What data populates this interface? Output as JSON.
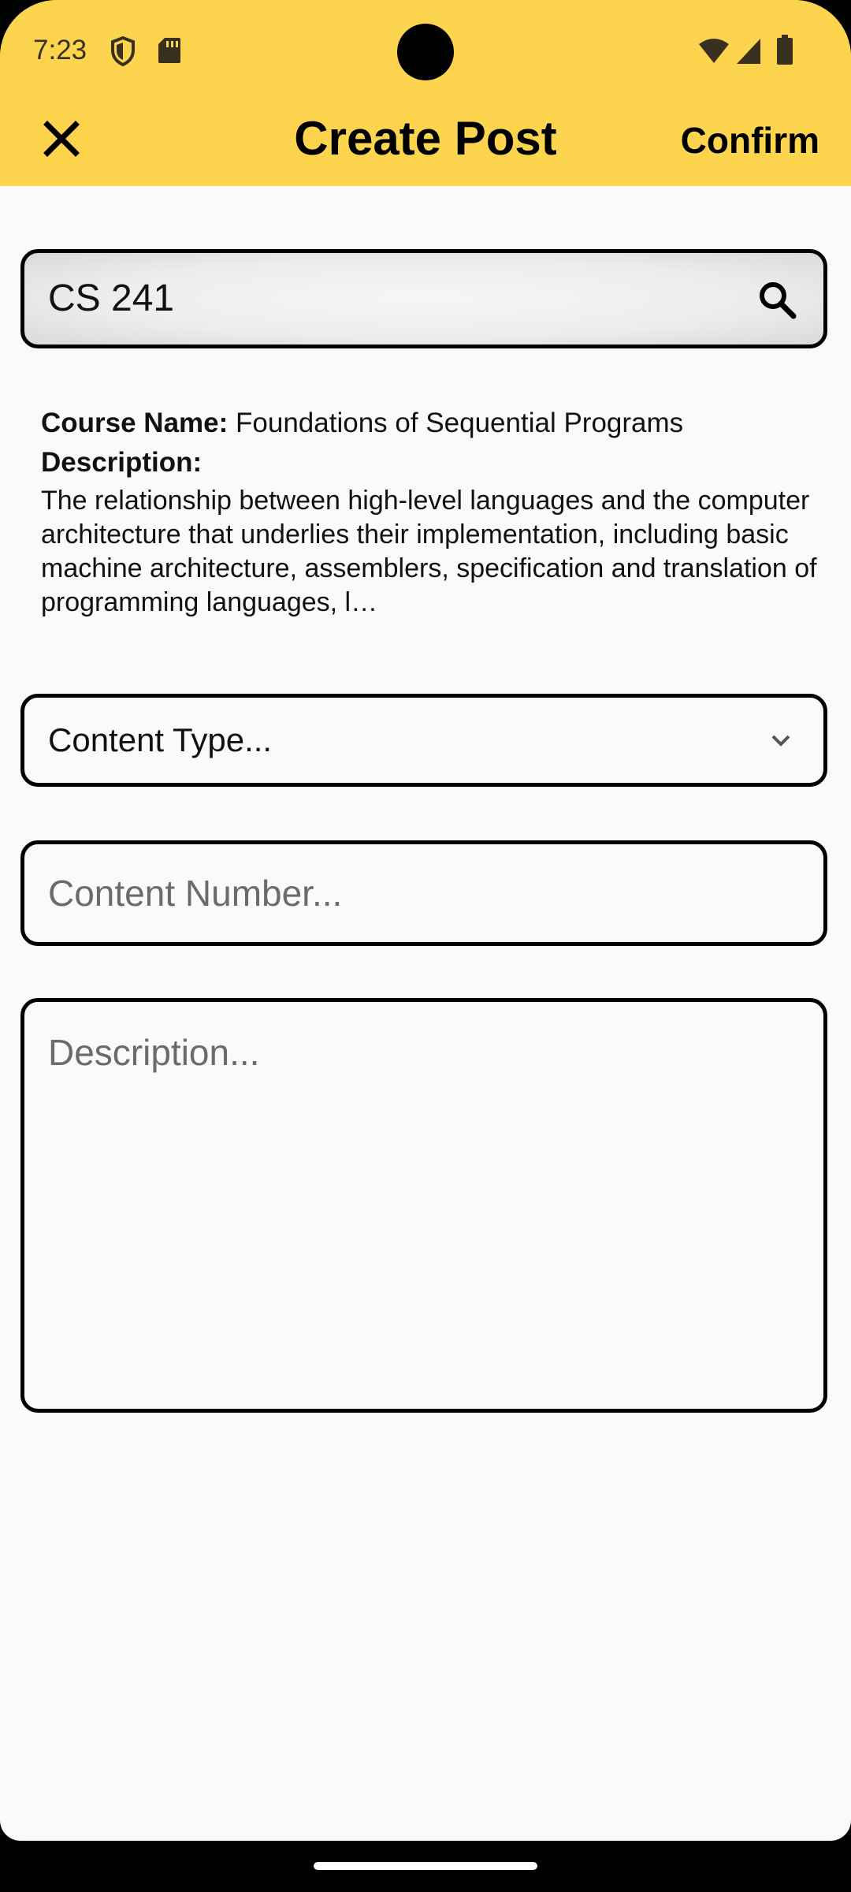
{
  "status_bar": {
    "time": "7:23",
    "left_icons": [
      "shield-icon",
      "sd-card-icon"
    ],
    "right_icons": [
      "wifi-icon",
      "signal-icon",
      "battery-icon"
    ]
  },
  "header": {
    "title": "Create Post",
    "confirm_label": "Confirm",
    "close_icon": "close-icon",
    "background_color": "#fdd44e"
  },
  "search": {
    "value": "CS 241",
    "icon": "search-icon"
  },
  "course": {
    "name_label": "Course Name:",
    "name_value": "Foundations of Sequential Programs",
    "description_label": "Description:",
    "description_value": "The relationship between high-level languages and the computer architecture that underlies their implementation, including basic machine architecture, assemblers, specification and translation of programming languages, l…"
  },
  "form": {
    "content_type_placeholder": "Content Type...",
    "content_number_placeholder": "Content Number...",
    "description_placeholder": "Description..."
  }
}
